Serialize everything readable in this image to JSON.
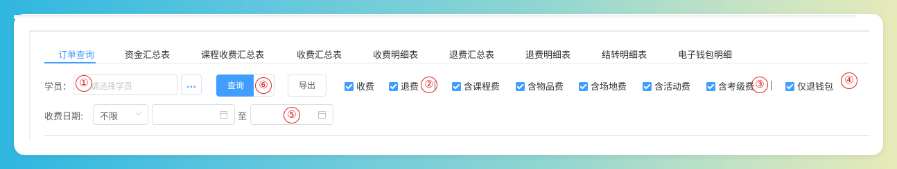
{
  "tabs": [
    {
      "label": "订单查询",
      "active": true
    },
    {
      "label": "资金汇总表"
    },
    {
      "label": "课程收费汇总表"
    },
    {
      "label": "收费汇总表"
    },
    {
      "label": "收费明细表"
    },
    {
      "label": "退费汇总表"
    },
    {
      "label": "退费明细表"
    },
    {
      "label": "结转明细表"
    },
    {
      "label": "电子钱包明细"
    }
  ],
  "filters": {
    "student_label": "学员：",
    "student_placeholder": "请选择学员",
    "more_button": "...",
    "query_button": "查询",
    "export_button": "导出",
    "date_label": "收费日期:",
    "date_range_select": "不限",
    "to_label": "至"
  },
  "checkboxes": [
    {
      "label": "收费",
      "checked": true
    },
    {
      "label": "退费",
      "checked": true
    },
    {
      "label": "含课程费",
      "checked": true
    },
    {
      "label": "含物品费",
      "checked": true
    },
    {
      "label": "含场地费",
      "checked": true
    },
    {
      "label": "含活动费",
      "checked": true
    },
    {
      "label": "含考级费",
      "checked": true
    },
    {
      "label": "仅退钱包",
      "checked": true
    }
  ],
  "annotations": [
    "①",
    "②",
    "③",
    "④",
    "⑤",
    "⑥"
  ],
  "colors": {
    "accent": "#409eff",
    "annotation": "#e02020"
  }
}
